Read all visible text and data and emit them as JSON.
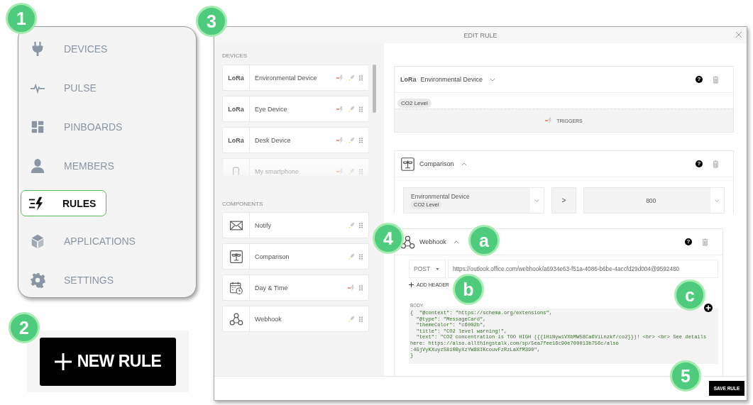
{
  "sidebar": {
    "items": [
      {
        "label": "DEVICES",
        "selected": false
      },
      {
        "label": "PULSE",
        "selected": false
      },
      {
        "label": "PINBOARDS",
        "selected": false
      },
      {
        "label": "MEMBERS",
        "selected": false
      },
      {
        "label": "RULES",
        "selected": true
      },
      {
        "label": "APPLICATIONS",
        "selected": false
      },
      {
        "label": "SETTINGS",
        "selected": false
      }
    ]
  },
  "new_rule_button": {
    "label": "NEW RULE"
  },
  "modal": {
    "title": "EDIT RULE",
    "palette": {
      "devices_heading": "DEVICES",
      "devices": [
        {
          "name": "Environmental Device",
          "logo": "LoRa",
          "trigger": true,
          "action": true
        },
        {
          "name": "Eye Device",
          "logo": "LoRa",
          "trigger": true,
          "action": true
        },
        {
          "name": "Desk Device",
          "logo": "LoRa",
          "trigger": true,
          "action": true
        },
        {
          "name": "My smartphone",
          "trigger": true,
          "action": true
        }
      ],
      "components_heading": "COMPONENTS",
      "components": [
        {
          "name": "Notify",
          "trigger": false,
          "action": true
        },
        {
          "name": "Comparison",
          "trigger": false,
          "action": true
        },
        {
          "name": "Day & Time",
          "trigger": true,
          "action": false
        },
        {
          "name": "Webhook",
          "trigger": false,
          "action": true
        }
      ]
    },
    "trigger_card": {
      "logo": "LoRa",
      "device": "Environmental Device",
      "expanded": false,
      "help": "?",
      "tag": "CO2 Level",
      "triggers_label": "TRIGGERS"
    },
    "comparison_card": {
      "title": "Comparison",
      "expanded": true,
      "help": "?",
      "left_value": "Environmental Device",
      "left_tag": "CO2 Level",
      "operator": ">",
      "right_value": "800"
    },
    "webhook_card": {
      "title": "Webhook",
      "expanded": true,
      "help": "?",
      "method": "POST",
      "url": "https://outlook.office.com/webhook/a6934e63-f51a-4086-b6be-4accfd29d004@9592480",
      "add_header": "ADD HEADER",
      "body_label": "BODY",
      "body": "{  \"@context\": \"https://schema.org/extensions\",\n  \"@type\": \"MessageCard\",\n  \"themeColor\": \"c6002b\",\n  \"title\": \"CO2 level warning!\",\n  \"text\": \"CO2 concentration is TOO HIGH ({{1HiNywiVXbMW58Ca6ViLnzkf/co2}})! <br> <br> See details\nhere: https://also.allthingstalk.com/sp/5ea7fee16c90e700013b756c/also\n:4GjVyKXuyzS8i0ByXzYW88IKcouvFzRzLaXfM390\",\n}"
    },
    "save_button": "SAVE RULE"
  },
  "callouts": [
    {
      "label": "1"
    },
    {
      "label": "2"
    },
    {
      "label": "3"
    },
    {
      "label": "4"
    },
    {
      "label": "a"
    },
    {
      "label": "b"
    },
    {
      "label": "c"
    },
    {
      "label": "5"
    }
  ]
}
